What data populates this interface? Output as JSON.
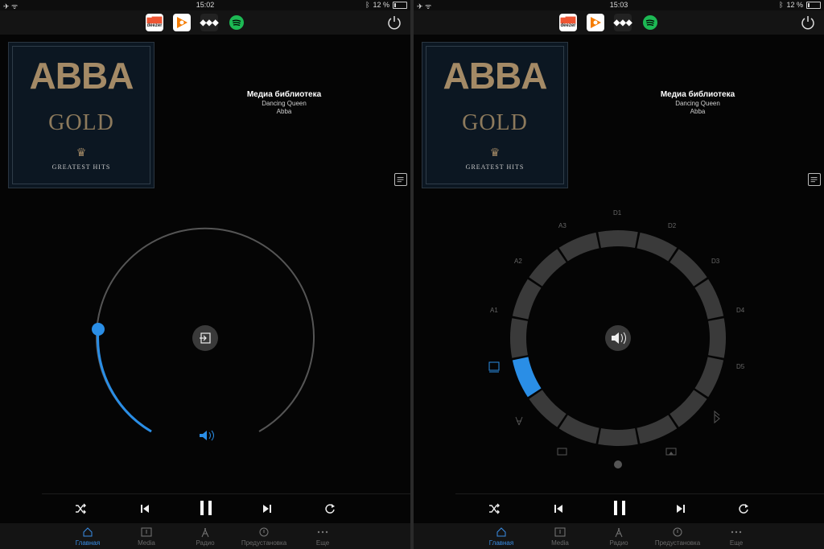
{
  "status_left": {
    "time": "15:02",
    "battery": "12 %"
  },
  "status_right": {
    "time": "15:03",
    "battery": "12 %"
  },
  "services": [
    "deezer",
    "google-play-music",
    "tidal",
    "spotify"
  ],
  "deezer_text": "deezer",
  "album": {
    "band": "ABBA",
    "title": "GOLD",
    "subtitle": "GREATEST HITS"
  },
  "track": {
    "source": "Медиа библиотека",
    "song": "Dancing Queen",
    "artist": "Abba"
  },
  "tabs": [
    {
      "label": "Главная",
      "icon": "home-icon",
      "active": true
    },
    {
      "label": "Media",
      "icon": "media-icon",
      "active": false
    },
    {
      "label": "Радио",
      "icon": "radio-icon",
      "active": false
    },
    {
      "label": "Предустановка",
      "icon": "preset-icon",
      "active": false
    },
    {
      "label": "Еще",
      "icon": "more-icon",
      "active": false
    }
  ],
  "zones": {
    "A3": "A3",
    "D1": "D1",
    "D2": "D2",
    "A2": "A2",
    "D3": "D3",
    "A1": "A1",
    "D4": "D4",
    "D5": "D5"
  },
  "volume_level_fraction": 0.12,
  "accent": "#2a8ee6"
}
